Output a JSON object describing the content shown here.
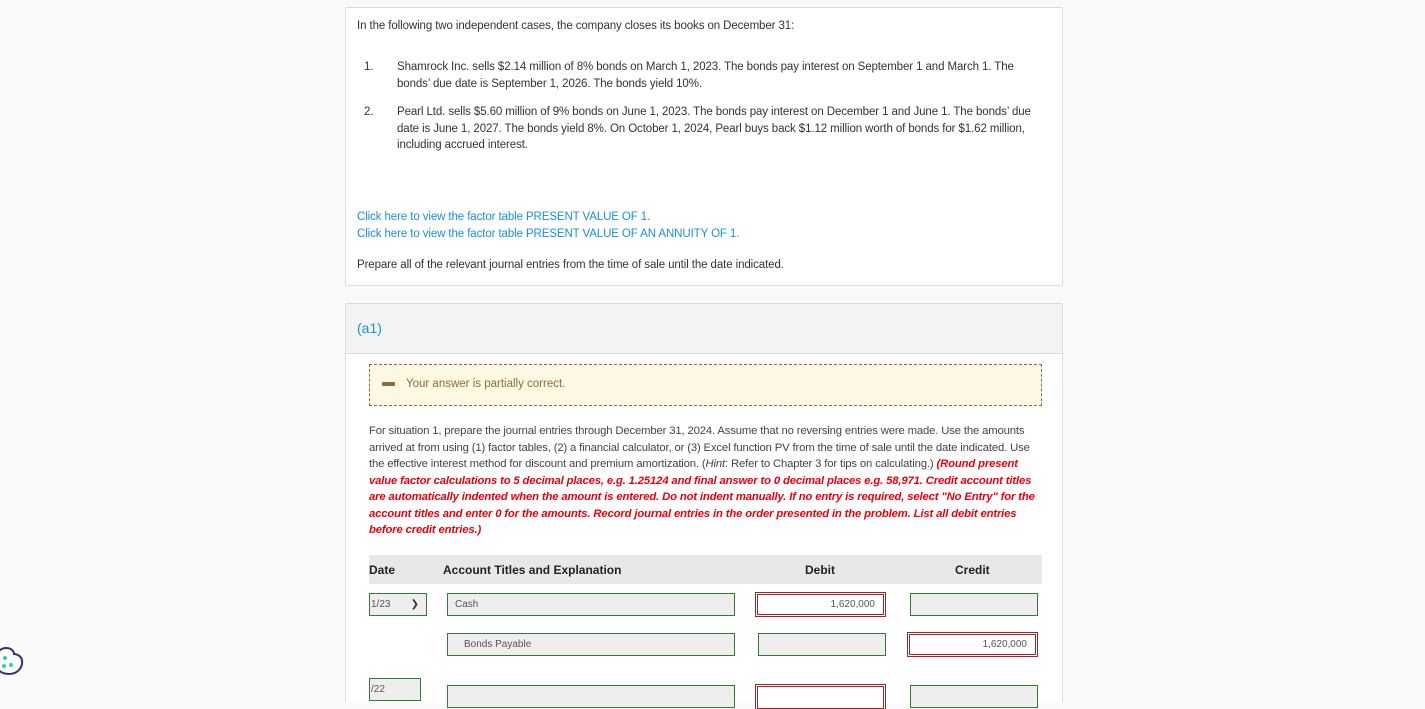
{
  "problem": {
    "intro": "In the following two independent cases, the company closes its books on December 31:",
    "cases": [
      {
        "num": "1.",
        "text": "Shamrock Inc. sells $2.14 million of 8% bonds on March 1, 2023. The bonds pay interest on September 1 and March 1. The bonds’ due date is September 1, 2026. The bonds yield 10%."
      },
      {
        "num": "2.",
        "text": "Pearl Ltd. sells $5.60 million of 9% bonds on June 1, 2023. The bonds pay interest on December 1 and June 1. The bonds’ due date is June 1, 2027. The bonds yield 8%. On October 1, 2024, Pearl buys back $1.12 million worth of bonds for $1.62 million, including accrued interest."
      }
    ],
    "links": [
      "Click here to view the factor table PRESENT VALUE OF 1.",
      "Click here to view the factor table PRESENT VALUE OF AN ANNUITY OF 1."
    ],
    "prepare": "Prepare all of the relevant journal entries from the time of sale until the date indicated."
  },
  "part": {
    "title": "(a1)",
    "feedback": "Your answer is partially correct.",
    "instructions": {
      "plain1": "For situation 1, prepare the journal entries through December 31, 2024. Assume that no reversing entries were made. Use the amounts arrived at from using (1) factor tables, (2) a financial calculator, or (3) Excel function PV from the time of sale until the date indicated. Use the effective interest method for discount and premium amortization. (",
      "hint_word": "Hint",
      "plain2": ": Refer to Chapter 3 for tips on calculating.) ",
      "red": "(Round present value factor calculations to 5 decimal places, e.g. 1.25124 and final answer to 0 decimal places e.g. 58,971. Credit account titles are automatically indented when the amount is entered. Do not indent manually. If no entry is required, select \"No Entry\" for the account titles and enter 0 for the amounts. Record journal entries in the order presented in the problem. List all debit entries before credit entries.)"
    },
    "table": {
      "headers": {
        "date": "Date",
        "account": "Account Titles and Explanation",
        "debit": "Debit",
        "credit": "Credit"
      },
      "rows": [
        {
          "date": "1/23",
          "account": "Cash",
          "debit": "1,620,000",
          "credit": ""
        },
        {
          "date": "",
          "account": "Bonds Payable",
          "debit": "",
          "credit": "1,620,000"
        },
        {
          "date": "/22",
          "account": "",
          "debit": "",
          "credit": ""
        }
      ]
    }
  },
  "icons": {
    "feedback": "partial-correct-minus-icon",
    "chevron": "chevron-down-icon",
    "cookie": "cookie-settings-icon"
  }
}
